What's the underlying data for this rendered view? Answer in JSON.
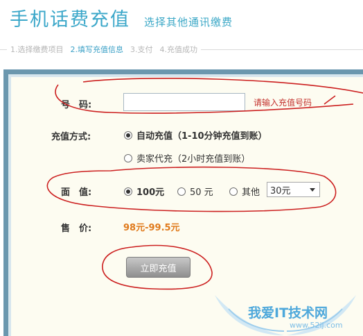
{
  "header": {
    "title": "手机话费充值",
    "sub_link": "选择其他通讯缴费"
  },
  "steps": [
    {
      "label": "1.选择缴费项目"
    },
    {
      "label": "2.填写充值信息"
    },
    {
      "label": "3.支付"
    },
    {
      "label": "4.充值成功"
    }
  ],
  "form": {
    "phone_label": "号　码:",
    "phone_value": "",
    "phone_hint": "请输入充值号码",
    "method_label": "充值方式:",
    "method_options": [
      {
        "label": "自动充值（1-10分钟充值到账）",
        "checked": true
      },
      {
        "label": "卖家代充（2小时充值到账）",
        "checked": false
      }
    ],
    "amount_label": "面　值:",
    "amount_options": [
      {
        "label": "100元",
        "checked": true
      },
      {
        "label": "50 元",
        "checked": false
      },
      {
        "label": "其他",
        "checked": false
      }
    ],
    "amount_other_selected": "30元",
    "price_label": "售　价:",
    "price_value": "98元-99.5元",
    "submit_label": "立即充值"
  },
  "watermark": {
    "text": "我爱IT技术网",
    "url": "www.52ij.com"
  },
  "colors": {
    "title": "#3ba7c9",
    "active_step": "#3aa0c6",
    "hint": "#c3302c",
    "price": "#e07a1c",
    "annotation": "#cc1f1f"
  }
}
